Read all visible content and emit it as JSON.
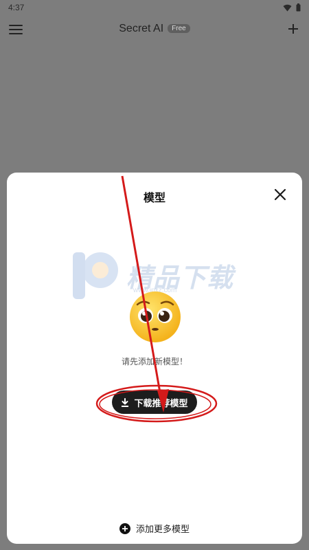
{
  "status_bar": {
    "time": "4:37",
    "icons": [
      "wifi-icon",
      "battery-icon"
    ]
  },
  "app_bar": {
    "title": "Secret AI",
    "badge": "Free",
    "menu_icon": "hamburger-menu-icon",
    "add_icon": "plus-icon"
  },
  "sheet": {
    "title": "模型",
    "close_icon": "close-icon",
    "empty_icon": "pleading-face-emoji",
    "empty_message": "请先添加新模型！",
    "download_button": "下载推荐模型",
    "download_icon": "download-icon",
    "add_more": "添加更多模型",
    "add_more_icon": "plus-circle-icon"
  },
  "watermark": {
    "text": "精品下载",
    "url": "www.jpxz.com"
  },
  "colors": {
    "scrim": "#7d7d7d",
    "sheet_bg": "#ffffff",
    "button_bg": "#1d1d1d",
    "annotation_red": "#d41a1a"
  }
}
